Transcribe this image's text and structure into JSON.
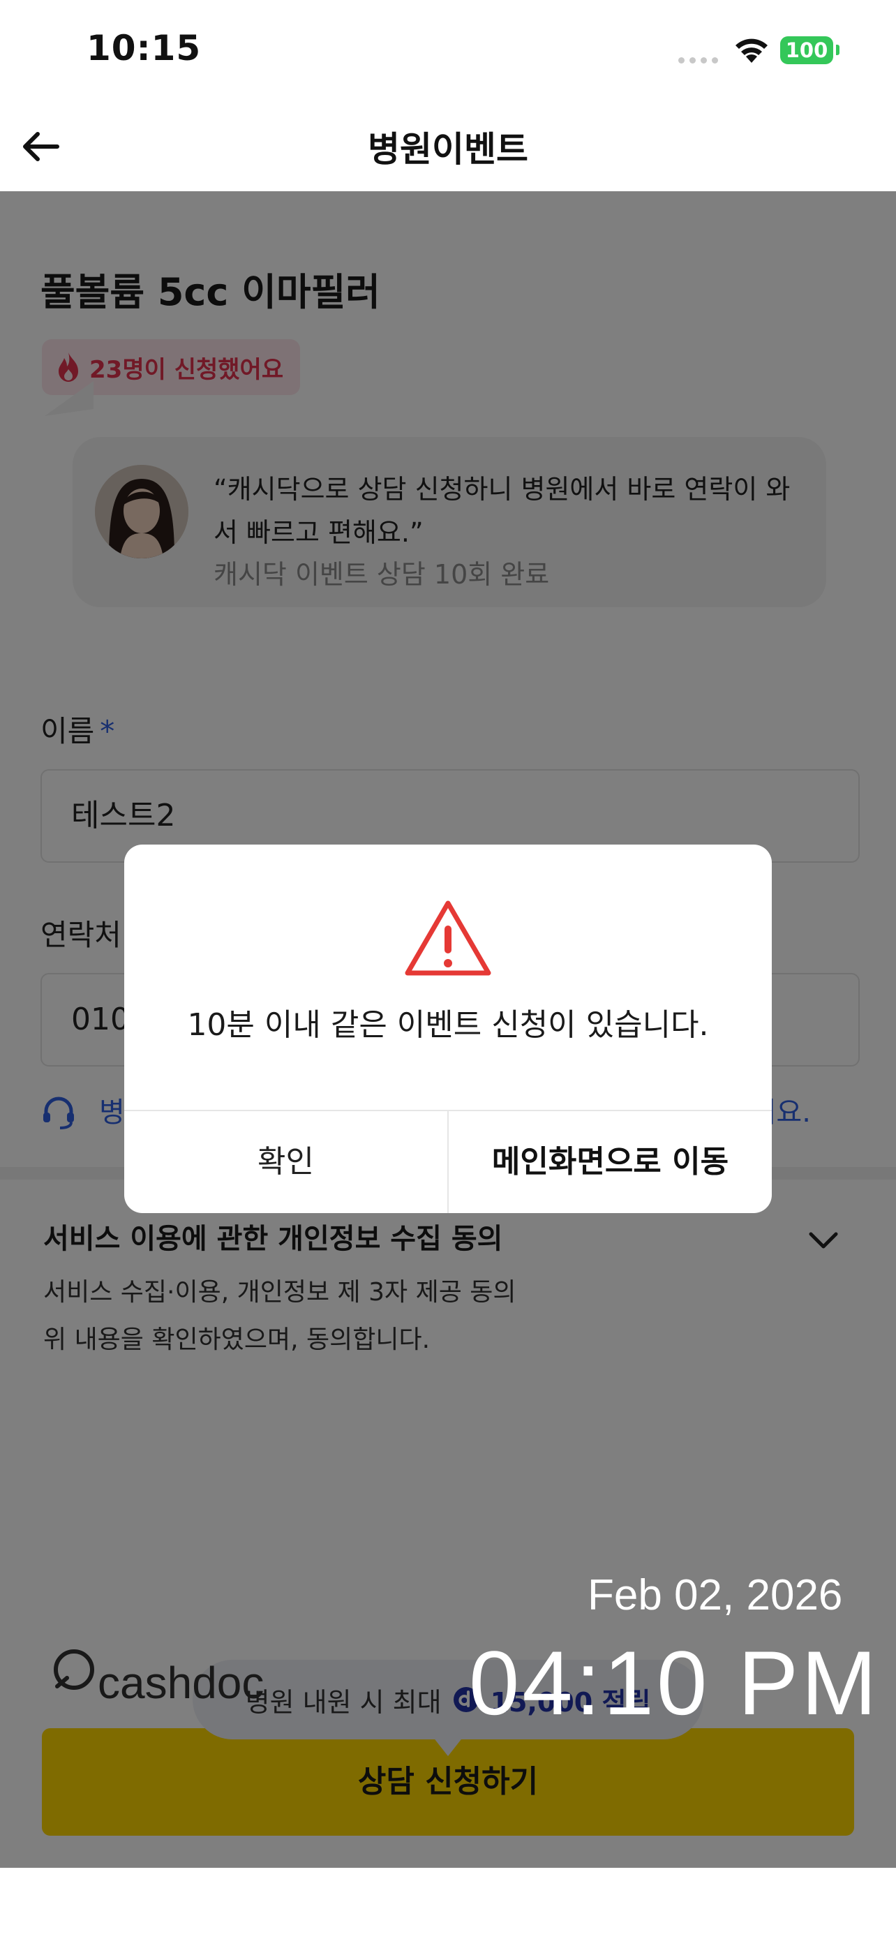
{
  "status_bar": {
    "time": "10:15",
    "battery": "100"
  },
  "nav": {
    "title": "병원이벤트"
  },
  "product": {
    "title": "풀볼륨 5cc 이마필러",
    "applied_badge": "23명이 신청했어요"
  },
  "review": {
    "quote": "“캐시닥으로 상담 신청하니 병원에서 바로 연락이 와서 빠르고 편해요.”",
    "meta": "캐시닥 이벤트 상담 10회 완료"
  },
  "form": {
    "name_label": "이름",
    "required_mark": "*",
    "name_value": "테스트2",
    "contact_label": "연락처",
    "contact_value": "010",
    "help_text_start": "병",
    "help_text_end": "있어요."
  },
  "consent": {
    "title": "서비스 이용에 관한 개인정보 수집 동의",
    "line1": "서비스 수집·이용, 개인정보 제 3자 제공 동의",
    "line2": "위 내용을 확인하였으며, 동의합니다."
  },
  "points": {
    "label": "병원 내원 시 최대",
    "amount": "15,000 적립"
  },
  "cta": {
    "label": "상담 신청하기"
  },
  "brand": {
    "logo_text": "cashdoc"
  },
  "overlay_stamp": {
    "date": "Feb 02, 2026",
    "time": "04:10 PM"
  },
  "modal": {
    "message": "10분 이내 같은 이벤트 신청이 있습니다.",
    "confirm_label": "확인",
    "home_label": "메인화면으로 이동"
  },
  "colors": {
    "accent_yellow": "#ffd600",
    "badge_red": "#e2324f",
    "link_blue": "#2f5fe0",
    "battery_green": "#34c759",
    "warning_red": "#e53935"
  },
  "icons": [
    "back-arrow-icon",
    "wifi-icon",
    "flame-icon",
    "headset-icon",
    "chevron-down-icon",
    "coin-icon",
    "warning-icon",
    "cashdoc-logo"
  ]
}
